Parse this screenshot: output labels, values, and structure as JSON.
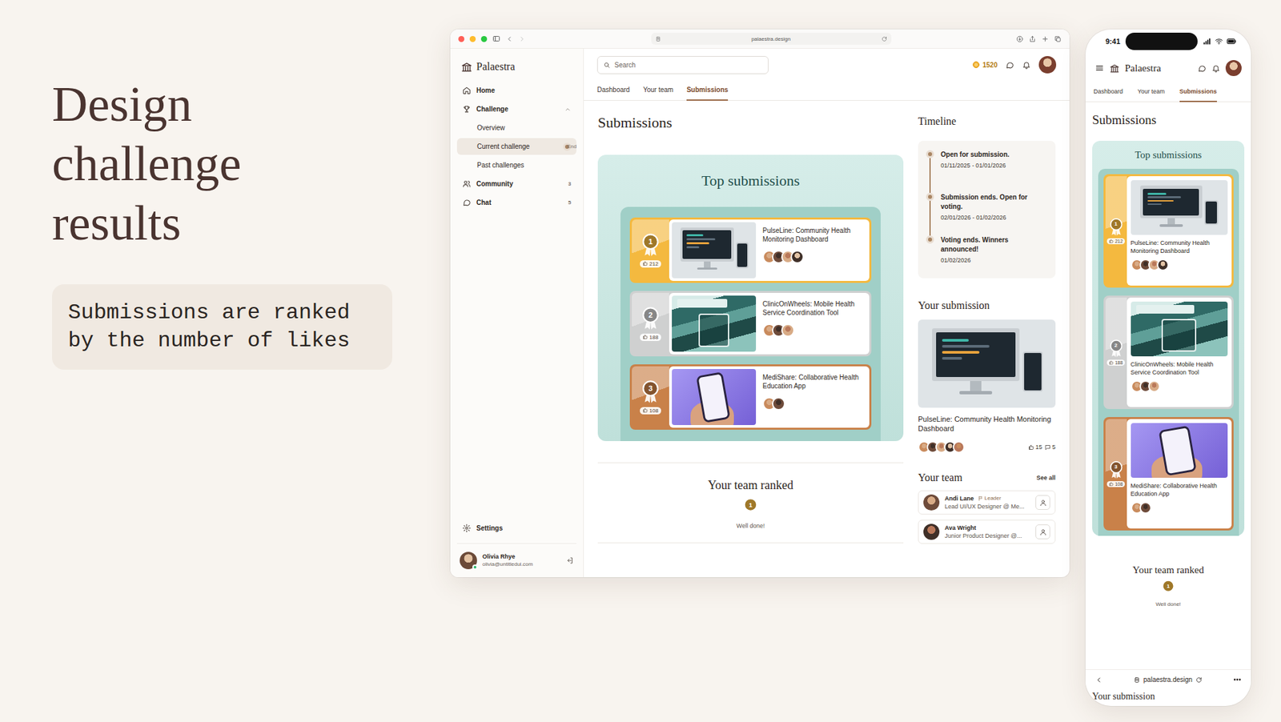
{
  "slide": {
    "title": "Design challenge results",
    "note": "Submissions are ranked by the number of likes"
  },
  "browser": {
    "url": "palaestra.design"
  },
  "desktop": {
    "brand": "Palaestra",
    "sidebar": {
      "items": [
        {
          "kind": "main",
          "label": "Home",
          "selected": false
        },
        {
          "kind": "main",
          "label": "Challenge",
          "selected": false,
          "expanded": true
        },
        {
          "kind": "sub",
          "label": "Overview",
          "selected": false
        },
        {
          "kind": "sub",
          "label": "Current challenge",
          "selected": true,
          "badge": "End"
        },
        {
          "kind": "sub",
          "label": "Past challenges",
          "selected": false
        },
        {
          "kind": "main",
          "label": "Community",
          "selected": false,
          "badge": "3"
        },
        {
          "kind": "main",
          "label": "Chat",
          "selected": false,
          "badge": "5"
        }
      ],
      "settings": "Settings",
      "user": {
        "name": "Olivia Rhye",
        "email": "olivia@untitledui.com",
        "online": true
      }
    },
    "search": {
      "placeholder": "Search"
    },
    "coins": "1520",
    "tabs": [
      {
        "label": "Dashboard",
        "selected": false
      },
      {
        "label": "Your team",
        "selected": false
      },
      {
        "label": "Submissions",
        "selected": true
      }
    ],
    "heading": "Submissions",
    "top_submissions": {
      "title": "Top submissions",
      "entries": [
        {
          "rank": "1",
          "likes": "212",
          "title": "PulseLine: Community Health Monitoring Dashboard",
          "avatars": 4,
          "kind": "dashboard",
          "color": "#f4b93f"
        },
        {
          "rank": "2",
          "likes": "188",
          "title": "ClinicOnWheels: Mobile Health Service Coordination Tool",
          "avatars": 3,
          "kind": "map",
          "color": "#cfd0d0"
        },
        {
          "rank": "3",
          "likes": "108",
          "title": "MediShare: Collaborative Health Education App",
          "avatars": 2,
          "kind": "phone",
          "color": "#c98149"
        }
      ]
    },
    "team_ranked": {
      "title": "Your team ranked",
      "rank": "1",
      "message": "Well done!"
    },
    "timeline": {
      "title": "Timeline",
      "steps": [
        {
          "title": "Open for submission.",
          "date": "01/11/2025 - 01/01/2026"
        },
        {
          "title": "Submission ends. Open for voting.",
          "date": "02/01/2026 - 01/02/2026"
        },
        {
          "title": "Voting ends. Winners announced!",
          "date": "01/02/2026"
        }
      ]
    },
    "your_submission": {
      "title": "Your submission",
      "project": "PulseLine: Community Health Monitoring Dashboard",
      "kind": "dashboard",
      "avatars": 5,
      "likes": "15",
      "comments": "5"
    },
    "your_team": {
      "title": "Your team",
      "link": "See all",
      "members": [
        {
          "name": "Andi Lane",
          "tag": "Leader",
          "role": "Lead UI/UX Designer @ Me..."
        },
        {
          "name": "Ava Wright",
          "role": "Junior Product Designer @..."
        }
      ]
    }
  },
  "phone": {
    "time": "9:41",
    "brand": "Palaestra",
    "tabs": [
      {
        "label": "Dashboard",
        "selected": false
      },
      {
        "label": "Your team",
        "selected": false
      },
      {
        "label": "Submissions",
        "selected": true
      }
    ],
    "heading": "Submissions",
    "top_submissions": {
      "title": "Top submissions",
      "entries": [
        {
          "rank": "1",
          "likes": "212",
          "title": "PulseLine: Community Health Monitoring Dashboard",
          "avatars": 4,
          "kind": "dashboard",
          "color": "#f4b93f"
        },
        {
          "rank": "2",
          "likes": "188",
          "title": "ClinicOnWheels: Mobile Health Service Coordination Tool",
          "avatars": 3,
          "kind": "map",
          "color": "#cfd0d0"
        },
        {
          "rank": "3",
          "likes": "108",
          "title": "MediShare: Collaborative Health Education App",
          "avatars": 2,
          "kind": "phone",
          "color": "#c98149"
        }
      ]
    },
    "team_ranked": {
      "title": "Your team ranked",
      "rank": "1",
      "message": "Well done!"
    },
    "url": "palaestra.design",
    "next_heading": "Your submission"
  }
}
